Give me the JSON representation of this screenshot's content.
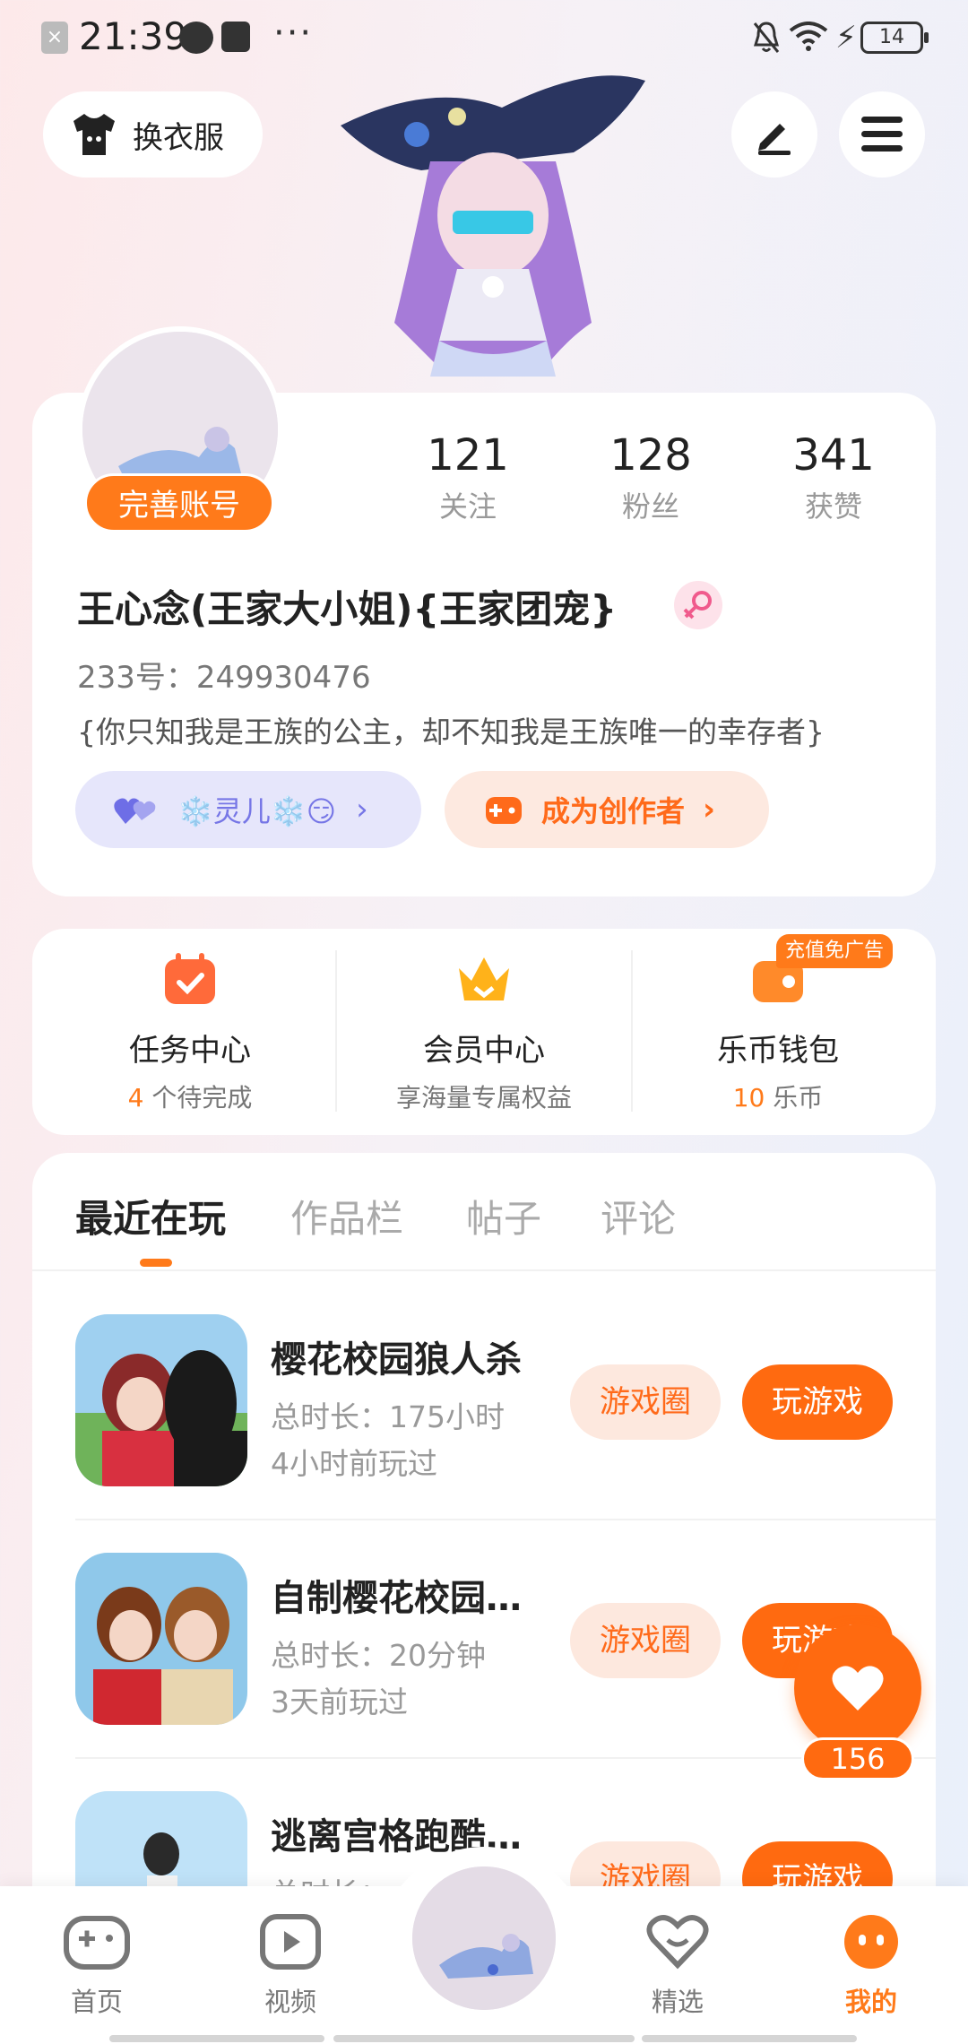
{
  "status_bar": {
    "time": "21:39",
    "battery": "14",
    "more": "···"
  },
  "header": {
    "outfit_label": "换衣服"
  },
  "profile": {
    "complete_label": "完善账号",
    "stats": [
      {
        "value": "121",
        "label": "关注"
      },
      {
        "value": "128",
        "label": "粉丝"
      },
      {
        "value": "341",
        "label": "获赞"
      }
    ],
    "name": "王心念(王家大小姐){王家团宠}",
    "uid": "233号：249930476",
    "bio": "{你只知我是王族的公主，却不知我是王族唯一的幸存者}",
    "friend_chip": "❄️灵儿❄️😏",
    "creator_chip": "成为创作者"
  },
  "services": {
    "task": {
      "title": "任务中心",
      "count": "4",
      "sub": "个待完成"
    },
    "vip": {
      "title": "会员中心",
      "sub": "享海量专属权益"
    },
    "wallet": {
      "title": "乐币钱包",
      "count": "10",
      "sub": "乐币",
      "badge": "充值免广告"
    }
  },
  "tabs": [
    "最近在玩",
    "作品栏",
    "帖子",
    "评论"
  ],
  "games": [
    {
      "name": "樱花校园狼人杀",
      "duration": "总时长：175小时",
      "last": "4小时前玩过",
      "circle": "游戏圈",
      "play": "玩游戏"
    },
    {
      "name": "自制樱花校园…",
      "duration": "总时长：20分钟",
      "last": "3天前玩过",
      "circle": "游戏圈",
      "play": "玩游戏"
    },
    {
      "name": "逃离宫格跑酷…",
      "duration": "总时长：",
      "last": "",
      "circle": "游戏圈",
      "play": "玩游戏"
    }
  ],
  "like": {
    "count": "156"
  },
  "nav": {
    "home": "首页",
    "video": "视频",
    "featured": "精选",
    "me": "我的"
  },
  "colors": {
    "accent": "#ff7a1a",
    "friend": "#7676e6"
  }
}
